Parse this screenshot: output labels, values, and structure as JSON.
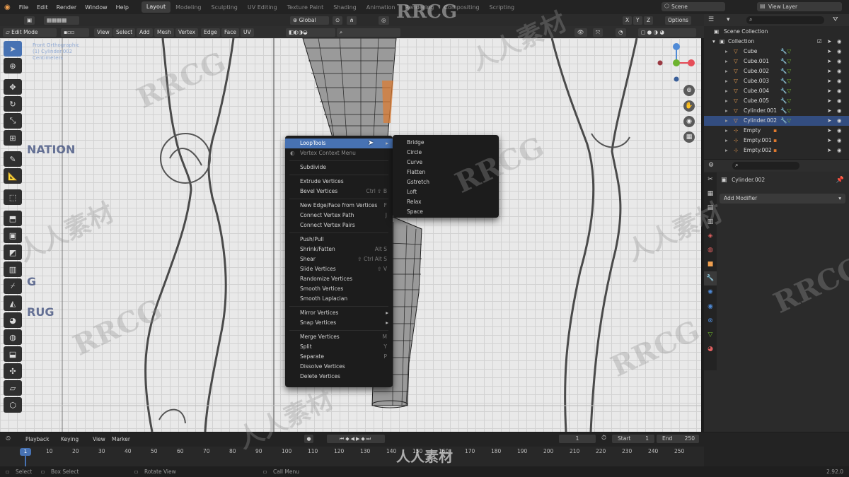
{
  "topbar": {
    "menus": [
      "File",
      "Edit",
      "Render",
      "Window",
      "Help"
    ],
    "workspaces": [
      "Layout",
      "Modeling",
      "Sculpting",
      "UV Editing",
      "Texture Paint",
      "Shading",
      "Animation",
      "Rendering",
      "Compositing",
      "Scripting"
    ],
    "scene": "Scene",
    "view_layer": "View Layer"
  },
  "tool_header": {
    "orientation": "Global",
    "axes": [
      "X",
      "Y",
      "Z"
    ],
    "options": "Options"
  },
  "viewport_header": {
    "mode": "Edit Mode",
    "menus": [
      "View",
      "Select",
      "Add",
      "Mesh",
      "Vertex",
      "Edge",
      "Face",
      "UV"
    ]
  },
  "viewport_overlay_text": [
    "Front Orthographic",
    "(1) Cylinder.002",
    "Centimeters"
  ],
  "viewport_sketch_text": [
    "NATION",
    "G",
    "RUG"
  ],
  "gizmo": {
    "x": "X",
    "y": "Y",
    "z": "Z",
    "nx": "-X",
    "ny": "-Y",
    "nz": "-Z"
  },
  "toolbar_icons": [
    "select-box-icon",
    "cursor-icon",
    "move-icon",
    "rotate-icon",
    "scale-icon",
    "transform-icon",
    "annotate-icon",
    "measure-icon",
    "add-cube-icon",
    "extrude-icon",
    "inset-icon",
    "bevel-icon",
    "loop-cut-icon",
    "knife-icon",
    "poly-build-icon",
    "spin-icon",
    "smooth-icon",
    "edge-slide-icon",
    "shrink-fatten-icon",
    "shear-icon",
    "rip-icon"
  ],
  "context_menu": {
    "items": [
      {
        "label": "LoopTools",
        "shortcut": "",
        "submenu": true,
        "highlight": true
      },
      {
        "label": "Vertex Context Menu",
        "shortcut": "",
        "dim": true
      },
      {
        "sep": true
      },
      {
        "label": "Subdivide",
        "shortcut": ""
      },
      {
        "sep": true
      },
      {
        "label": "Extrude Vertices",
        "shortcut": ""
      },
      {
        "label": "Bevel Vertices",
        "shortcut": "Ctrl ⇧ B"
      },
      {
        "sep": true
      },
      {
        "label": "New Edge/Face from Vertices",
        "shortcut": "F"
      },
      {
        "label": "Connect Vertex Path",
        "shortcut": "J"
      },
      {
        "label": "Connect Vertex Pairs",
        "shortcut": ""
      },
      {
        "sep": true
      },
      {
        "label": "Push/Pull",
        "shortcut": ""
      },
      {
        "label": "Shrink/Fatten",
        "shortcut": "Alt S"
      },
      {
        "label": "Shear",
        "shortcut": "⇧ Ctrl Alt S"
      },
      {
        "label": "Slide Vertices",
        "shortcut": "⇧ V"
      },
      {
        "label": "Randomize Vertices",
        "shortcut": ""
      },
      {
        "label": "Smooth Vertices",
        "shortcut": ""
      },
      {
        "label": "Smooth Laplacian",
        "shortcut": ""
      },
      {
        "sep": true
      },
      {
        "label": "Mirror Vertices",
        "shortcut": "",
        "submenu": true
      },
      {
        "label": "Snap Vertices",
        "shortcut": "",
        "submenu": true
      },
      {
        "sep": true
      },
      {
        "label": "Merge Vertices",
        "shortcut": "M"
      },
      {
        "label": "Split",
        "shortcut": "Y"
      },
      {
        "label": "Separate",
        "shortcut": "P"
      },
      {
        "label": "Dissolve Vertices",
        "shortcut": ""
      },
      {
        "label": "Delete Vertices",
        "shortcut": ""
      }
    ]
  },
  "looptools_menu": {
    "items": [
      "Bridge",
      "Circle",
      "Curve",
      "Flatten",
      "Gstretch",
      "Loft",
      "Relax",
      "Space"
    ]
  },
  "outliner": {
    "root": "Scene Collection",
    "collection": "Collection",
    "objects": [
      {
        "name": "Cube",
        "type": "mesh",
        "selected": false
      },
      {
        "name": "Cube.001",
        "type": "mesh",
        "selected": false
      },
      {
        "name": "Cube.002",
        "type": "mesh",
        "selected": false
      },
      {
        "name": "Cube.003",
        "type": "mesh",
        "selected": false
      },
      {
        "name": "Cube.004",
        "type": "mesh",
        "selected": false
      },
      {
        "name": "Cube.005",
        "type": "mesh",
        "selected": false
      },
      {
        "name": "Cylinder.001",
        "type": "mesh",
        "selected": false
      },
      {
        "name": "Cylinder.002",
        "type": "mesh",
        "selected": true
      },
      {
        "name": "Empty",
        "type": "empty",
        "selected": false
      },
      {
        "name": "Empty.001",
        "type": "empty",
        "selected": false
      },
      {
        "name": "Empty.002",
        "type": "empty",
        "selected": false
      }
    ]
  },
  "properties": {
    "object_name": "Cylinder.002",
    "add_modifier": "Add Modifier"
  },
  "timeline": {
    "menus": [
      "Playback",
      "Keying",
      "View",
      "Marker"
    ],
    "current_frame": "1",
    "start_label": "Start",
    "start": "1",
    "end_label": "End",
    "end": "250",
    "frame_marker": "1",
    "ticks": [
      "10",
      "20",
      "30",
      "40",
      "50",
      "60",
      "70",
      "80",
      "90",
      "100",
      "110",
      "120",
      "130",
      "140",
      "150",
      "160",
      "170",
      "180",
      "190",
      "200",
      "210",
      "220",
      "230",
      "240",
      "250"
    ]
  },
  "status_bar": {
    "select": "Select",
    "box_select": "Box Select",
    "rotate_view": "Rotate View",
    "call_menu": "Call Menu",
    "version": "2.92.0"
  },
  "watermarks": [
    "RRCG",
    "人人素材"
  ],
  "colors": {
    "accent": "#4772b3",
    "selection": "#334d80",
    "active_vertex": "#e07a2e",
    "x_axis": "#e64e59",
    "y_axis": "#6db32e",
    "z_axis": "#4f8ad6"
  }
}
